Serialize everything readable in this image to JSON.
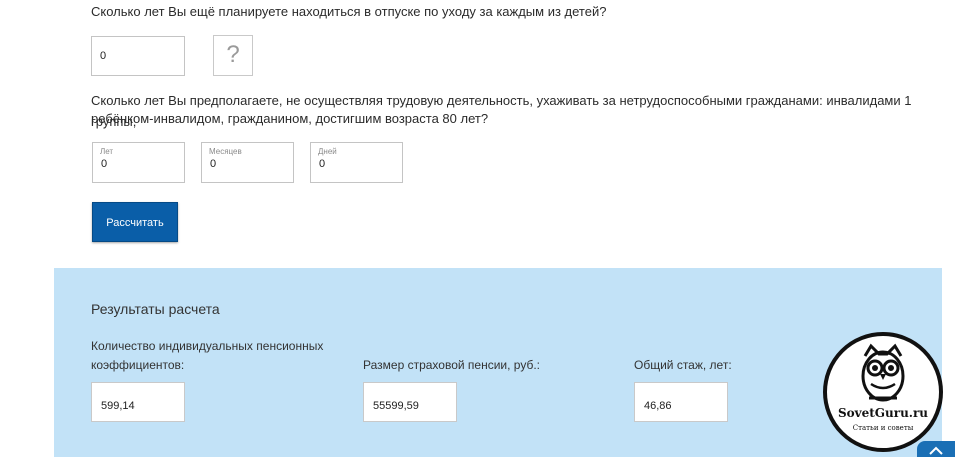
{
  "questions": {
    "q_leave": "Сколько лет Вы ещё планируете находиться в отпуске по уходу за каждым из детей?",
    "q_leave_value": "0",
    "q_leave_help": "?",
    "q_care_line1": "Сколько лет Вы предполагаете, не осуществляя трудовую деятельность, ухаживать за нетрудоспособными гражданами: инвалидами 1 группы,",
    "q_care_line2": "ребёнком-инвалидом, гражданином, достигшим возраста 80 лет?",
    "years_label": "Лет",
    "years_value": "0",
    "months_label": "Месяцев",
    "months_value": "0",
    "days_label": "Дней",
    "days_value": "0"
  },
  "calculate_button": "Рассчитать",
  "results": {
    "title": "Результаты расчета",
    "ipk_label_line1": "Количество индивидуальных пенсионных",
    "ipk_label_line2": "коэффициентов:",
    "ipk_value": "599,14",
    "pension_label": "Размер страховой пенсии, руб.:",
    "pension_value": "55599,59",
    "experience_label": "Общий стаж, лет:",
    "experience_value": "46,86"
  },
  "watermark": {
    "site": "SovetGuru.ru",
    "tagline": "Статьи и советы"
  },
  "colors": {
    "button": "#0a5ea8",
    "panel": "#c2e2f7",
    "corner": "#1a6fb5"
  }
}
